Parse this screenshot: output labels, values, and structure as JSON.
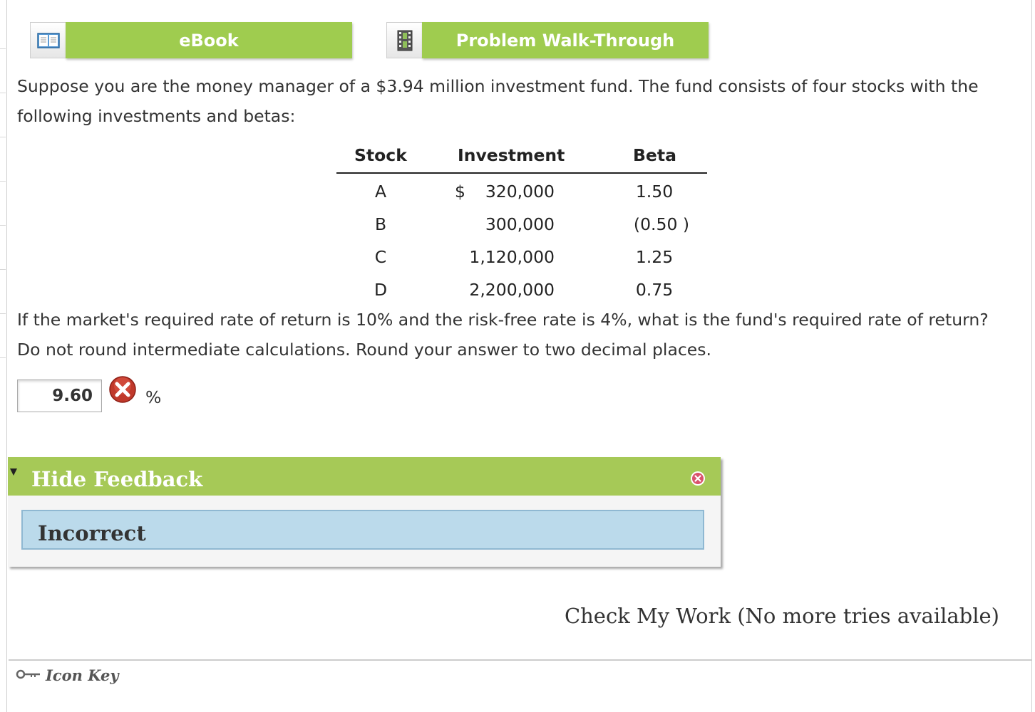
{
  "toolbar": {
    "ebook_label": "eBook",
    "walkthrough_label": "Problem Walk-Through"
  },
  "question": {
    "intro": "Suppose you are the money manager of a $3.94 million investment fund. The fund consists of four stocks with the following investments and betas:",
    "prompt": "If the market's required rate of return is 10% and the risk-free rate is 4%, what is the fund's required rate of return? Do not round intermediate calculations. Round your answer to two decimal places."
  },
  "table": {
    "headers": {
      "stock": "Stock",
      "investment": "Investment",
      "beta": "Beta"
    },
    "currency_symbol": "$",
    "rows": [
      {
        "stock": "A",
        "investment": "320,000",
        "beta": "1.50"
      },
      {
        "stock": "B",
        "investment": "300,000",
        "beta": "(0.50 )"
      },
      {
        "stock": "C",
        "investment": "1,120,000",
        "beta": "1.25"
      },
      {
        "stock": "D",
        "investment": "2,200,000",
        "beta": "0.75"
      }
    ]
  },
  "answer": {
    "value": "9.60",
    "unit": "%",
    "status": "incorrect"
  },
  "feedback": {
    "toggle_label": "Hide Feedback",
    "status_text": "Incorrect"
  },
  "check_work_label": "Check My Work (No more tries available)",
  "icon_key_label": "Icon Key",
  "colors": {
    "button_green": "#9fcc4f",
    "feedback_header": "#a6c957",
    "feedback_body": "#bbdaeb",
    "error_red": "#c0392b"
  }
}
